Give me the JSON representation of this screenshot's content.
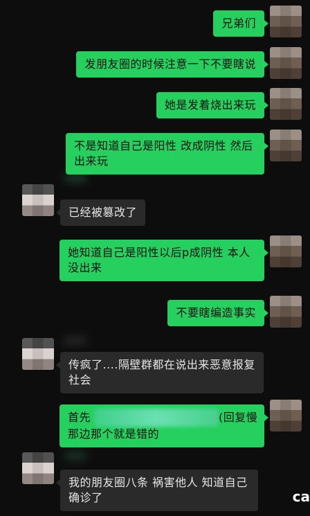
{
  "messages": [
    {
      "id": "m1",
      "dir": "out",
      "text": "兄弟们"
    },
    {
      "id": "m2",
      "dir": "out",
      "text": "发朋友圈的时候注意一下不要瞎说"
    },
    {
      "id": "m3",
      "dir": "out",
      "text": "她是发着烧出来玩"
    },
    {
      "id": "m4",
      "dir": "out",
      "text": "不是知道自己是阳性 改成阴性 然后出来玩"
    },
    {
      "id": "m5",
      "dir": "in",
      "text": "已经被篡改了"
    },
    {
      "id": "m6",
      "dir": "out",
      "text": "她知道自己是阳性以后p成阴性 本人没出来"
    },
    {
      "id": "m7",
      "dir": "out",
      "text": "不要瞎编造事实"
    },
    {
      "id": "m8",
      "dir": "in",
      "text": "传疯了....隔壁群都在说出来恶意报复社会"
    },
    {
      "id": "m9a",
      "dir": "out",
      "text": "首先"
    },
    {
      "id": "m9b",
      "dir": "out",
      "text": "(回复慢"
    },
    {
      "id": "m9c",
      "dir": "out",
      "text": "那边那个就是错的"
    },
    {
      "id": "m10",
      "dir": "in",
      "text": "我的朋友圈八条 祸害他人 知道自己确诊了"
    }
  ],
  "watermark": "ca",
  "icons": {
    "avatar_me": "avatar-blurred",
    "avatar_them": "avatar-blurred"
  },
  "colors": {
    "outgoing_bubble": "#25d05e",
    "incoming_bubble": "#2a2a2a",
    "background": "#0d0d0d"
  }
}
